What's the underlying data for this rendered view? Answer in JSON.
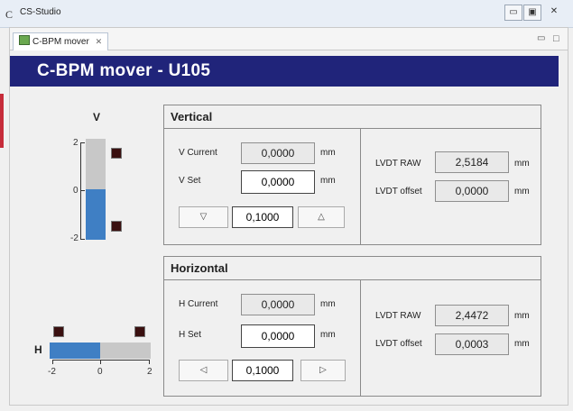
{
  "window": {
    "logo": "C",
    "title": "CS-Studio",
    "buttons": {
      "minimize": "▭",
      "maximize": "▣",
      "close": "✕"
    }
  },
  "tab": {
    "label": "C-BPM mover",
    "close": "✕"
  },
  "view_controls": {
    "minimize": "▭",
    "maximize": "□"
  },
  "header": {
    "title": "C-BPM mover - U105"
  },
  "v_meter": {
    "label": "V",
    "scale": [
      "2",
      "0",
      "-2"
    ],
    "value": 0.0
  },
  "h_meter": {
    "label": "H",
    "scale": [
      "-2",
      "0",
      "2"
    ],
    "value": 0.0
  },
  "vertical": {
    "title": "Vertical",
    "current_label": "V Current",
    "current_value": "0,0000",
    "current_unit": "mm",
    "set_label": "V Set",
    "set_value": "0,0000",
    "set_unit": "mm",
    "down": "▽",
    "step": "0,1000",
    "up": "△",
    "raw_label": "LVDT RAW",
    "raw_value": "2,5184",
    "raw_unit": "mm",
    "offset_label": "LVDT offset",
    "offset_value": "0,0000",
    "offset_unit": "mm"
  },
  "horizontal": {
    "title": "Horizontal",
    "current_label": "H Current",
    "current_value": "0,0000",
    "current_unit": "mm",
    "set_label": "H Set",
    "set_value": "0,0000",
    "set_unit": "mm",
    "left": "◁",
    "step": "0,1000",
    "right": "▷",
    "raw_label": "LVDT RAW",
    "raw_value": "2,4472",
    "raw_unit": "mm",
    "offset_label": "LVDT offset",
    "offset_value": "0,0003",
    "offset_unit": "mm"
  },
  "colors": {
    "header_bg": "#20247a",
    "meter_fill": "#3f7fc4",
    "led_off": "#3a1010"
  }
}
